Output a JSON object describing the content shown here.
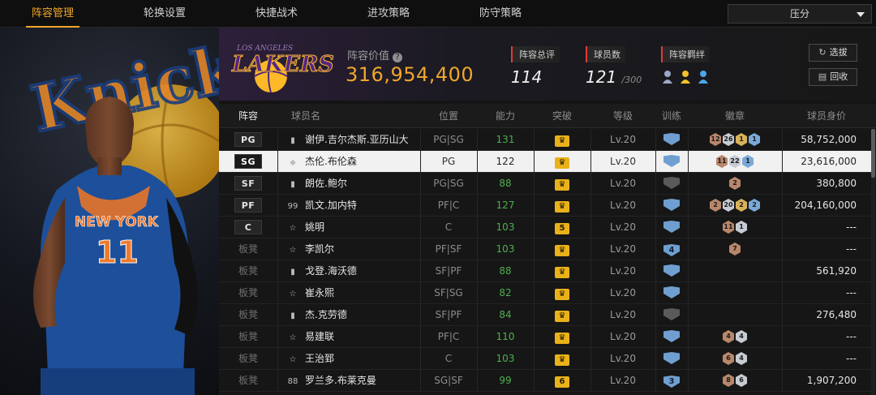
{
  "nav": {
    "tabs": [
      "阵容管理",
      "轮换设置",
      "快捷战术",
      "进攻策略",
      "防守策略"
    ],
    "active_index": 0,
    "sort": {
      "selected": "压分"
    }
  },
  "header": {
    "team_logo_text": "LAKERS",
    "team_logo_sub": "LOS ANGELES",
    "lineup_value_label": "阵容价值",
    "lineup_value": "316,954,400",
    "overall_label": "阵容总评",
    "overall": "114",
    "players_label": "球员数",
    "players_count": "121",
    "players_max": "/300",
    "bond_label": "阵容羁绊",
    "buttons": {
      "select": "选拔",
      "recycle": "回收"
    }
  },
  "table": {
    "headers": [
      "阵容",
      "球员名",
      "位置",
      "能力",
      "突破",
      "等级",
      "训练",
      "徽章",
      "球员身价"
    ],
    "rows": [
      {
        "slot": "PG",
        "starter": true,
        "tier": "bars",
        "name": "谢伊.吉尔杰斯.亚历山大",
        "pos": "PG|SG",
        "ability": "131",
        "breakthrough": "",
        "level": "Lv.20",
        "training": "",
        "badges": [
          {
            "t": "bronze",
            "v": "12"
          },
          {
            "t": "silver",
            "v": "26"
          },
          {
            "t": "gold",
            "v": "1"
          },
          {
            "t": "blue",
            "v": "1"
          }
        ],
        "value": "58,752,000",
        "selected": false
      },
      {
        "slot": "SG",
        "starter": true,
        "tier": "diamond",
        "name": "杰伦.布伦森",
        "pos": "PG",
        "ability": "122",
        "breakthrough": "",
        "level": "Lv.20",
        "training": "",
        "badges": [
          {
            "t": "bronze",
            "v": "11"
          },
          {
            "t": "silver",
            "v": "22"
          },
          {
            "t": "blue",
            "v": "1"
          }
        ],
        "value": "23,616,000",
        "selected": true
      },
      {
        "slot": "SF",
        "starter": true,
        "tier": "bars",
        "name": "朗佐.鲍尔",
        "pos": "PG|SG",
        "ability": "88",
        "breakthrough": "",
        "level": "Lv.20",
        "training": "",
        "badges": [
          {
            "t": "bronze",
            "v": "2"
          }
        ],
        "value": "380,800",
        "selected": false
      },
      {
        "slot": "PF",
        "starter": true,
        "tier": "99",
        "name": "凯文.加内特",
        "pos": "PF|C",
        "ability": "127",
        "breakthrough": "",
        "level": "Lv.20",
        "training": "",
        "badges": [
          {
            "t": "bronze",
            "v": "2"
          },
          {
            "t": "silver",
            "v": "20"
          },
          {
            "t": "gold",
            "v": "2"
          },
          {
            "t": "blue",
            "v": "2"
          }
        ],
        "value": "204,160,000",
        "selected": false
      },
      {
        "slot": "C",
        "starter": true,
        "tier": "star",
        "name": "姚明",
        "pos": "C",
        "ability": "103",
        "breakthrough": "5",
        "level": "Lv.20",
        "training": "",
        "badges": [
          {
            "t": "bronze",
            "v": "11"
          },
          {
            "t": "silver",
            "v": "1"
          }
        ],
        "value": "---",
        "selected": false
      },
      {
        "slot": "板凳",
        "starter": false,
        "tier": "star",
        "name": "李凯尔",
        "pos": "PF|SF",
        "ability": "103",
        "breakthrough": "",
        "level": "Lv.20",
        "training": "4",
        "badges": [
          {
            "t": "bronze",
            "v": "7"
          }
        ],
        "value": "---",
        "selected": false
      },
      {
        "slot": "板凳",
        "starter": false,
        "tier": "bars",
        "name": "戈登.海沃德",
        "pos": "SF|PF",
        "ability": "88",
        "breakthrough": "",
        "level": "Lv.20",
        "training": "",
        "badges": [],
        "value": "561,920",
        "selected": false
      },
      {
        "slot": "板凳",
        "starter": false,
        "tier": "star",
        "name": "崔永熙",
        "pos": "SF|SG",
        "ability": "82",
        "breakthrough": "",
        "level": "Lv.20",
        "training": "",
        "badges": [],
        "value": "---",
        "selected": false
      },
      {
        "slot": "板凳",
        "starter": false,
        "tier": "bars",
        "name": "杰.克劳德",
        "pos": "SF|PF",
        "ability": "84",
        "breakthrough": "",
        "level": "Lv.20",
        "training": "",
        "badges": [],
        "value": "276,480",
        "selected": false
      },
      {
        "slot": "板凳",
        "starter": false,
        "tier": "star",
        "name": "易建联",
        "pos": "PF|C",
        "ability": "110",
        "breakthrough": "",
        "level": "Lv.20",
        "training": "",
        "badges": [
          {
            "t": "bronze",
            "v": "4"
          },
          {
            "t": "silver",
            "v": "4"
          }
        ],
        "value": "---",
        "selected": false
      },
      {
        "slot": "板凳",
        "starter": false,
        "tier": "star",
        "name": "王治郅",
        "pos": "C",
        "ability": "103",
        "breakthrough": "",
        "level": "Lv.20",
        "training": "",
        "badges": [
          {
            "t": "bronze",
            "v": "6"
          },
          {
            "t": "silver",
            "v": "4"
          }
        ],
        "value": "---",
        "selected": false
      },
      {
        "slot": "板凳",
        "starter": false,
        "tier": "88",
        "name": "罗兰多.布莱克曼",
        "pos": "SG|SF",
        "ability": "99",
        "breakthrough": "6",
        "level": "Lv.20",
        "training": "3",
        "badges": [
          {
            "t": "bronze",
            "v": "8"
          },
          {
            "t": "silver",
            "v": "6"
          }
        ],
        "value": "1,907,200",
        "selected": false
      }
    ]
  },
  "hero": {
    "jersey_team": "NEW YORK",
    "jersey_number": "11",
    "background_text": "Knicks"
  },
  "colors": {
    "accent": "#f0a62a",
    "lakers_purple": "#552583",
    "lakers_gold": "#fdb927",
    "knicks_blue": "#1d4f9a",
    "knicks_orange": "#f07a2b"
  }
}
